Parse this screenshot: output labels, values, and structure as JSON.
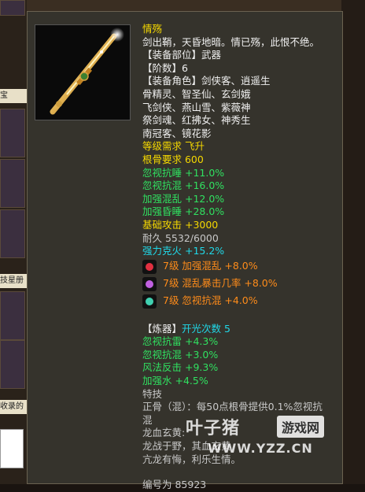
{
  "background": {
    "left_labels": [
      "宝",
      "技星册",
      "收录的"
    ]
  },
  "item": {
    "title": "情殇",
    "description": "剑出鞘，天昏地暗。情已殇，此恨不绝。",
    "slot": "【装备部位】武器",
    "tier_label": "【阶数】",
    "tier_value": "6",
    "roles_lines": [
      "【装备角色】剑侠客、逍遥生",
      "骨精灵、智圣仙、玄剑娥",
      "飞剑侠、燕山雪、紫薇神",
      "祭剑魂、红拂女、神秀生",
      "南冠客、镜花影"
    ],
    "level_req": "等级需求 飞升",
    "root_req": "根骨要求 600",
    "stats_green": [
      "忽视抗睡 +11.0%",
      "忽视抗混 +16.0%",
      "加强混乱 +12.0%",
      "加强昏睡 +28.0%",
      "基础攻击 +3000"
    ],
    "durability": "耐久 5532/6000",
    "counter": "强力克火 +15.2%",
    "gems": [
      {
        "icon": "red-gem-icon",
        "color": "#e03040",
        "text": "7级 加强混乱 +8.0%"
      },
      {
        "icon": "purple-gem-icon",
        "color": "#c060e0",
        "text": "7级 混乱暴击几率 +8.0%"
      },
      {
        "icon": "teal-gem-icon",
        "color": "#40d0b0",
        "text": "7级 忽视抗混 +4.0%"
      }
    ],
    "refine_label": "【炼器】",
    "refine_value": "开光次数 5",
    "refine_stats": [
      "忽视抗雷 +4.3%",
      "忽视抗混 +3.0%",
      "风法反击 +9.3%",
      "加强水 +4.5%"
    ],
    "skill_header": "特技",
    "skill_text": "正骨（混）：每50点根骨提供0.1%忽视抗混",
    "set_name": "龙血玄黄:",
    "set_lines": [
      "龙战于野，其血玄黄",
      "亢龙有悔，利乐生情。"
    ],
    "serial": "编号为 85923"
  },
  "watermark": {
    "logo": "叶子猪",
    "box": "游戏网",
    "url": "WWW.YZZ.CN"
  }
}
